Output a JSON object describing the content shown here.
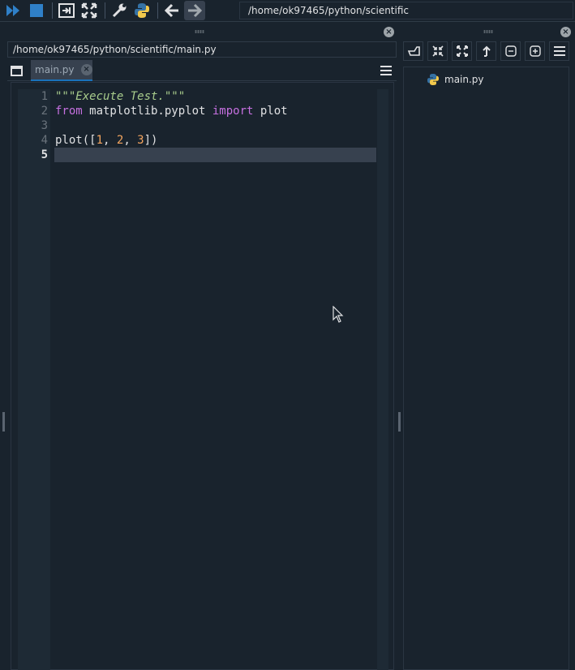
{
  "toolbar": {
    "path": "/home/ok97465/python/scientific",
    "icons": [
      "run-icon",
      "stop-icon",
      "maximize-editor-icon",
      "fullscreen-icon",
      "preferences-icon",
      "python-icon",
      "back-arrow-icon",
      "forward-arrow-icon"
    ]
  },
  "editor": {
    "file_path": "/home/ok97465/python/scientific/main.py",
    "tab_label": "main.py",
    "line_numbers": [
      "1",
      "2",
      "3",
      "4",
      "5"
    ],
    "current_line": 5,
    "lines": {
      "l1": "\"\"\"Execute Test.\"\"\"",
      "l2_kw1": "from",
      "l2_mod": " matplotlib.pyplot ",
      "l2_kw2": "import",
      "l2_name": " plot",
      "l4_a": "plot([",
      "l4_n1": "1",
      "l4_b": ", ",
      "l4_n2": "2",
      "l4_c": ", ",
      "l4_n3": "3",
      "l4_d": "])"
    }
  },
  "files": {
    "items": [
      {
        "label": "main.py",
        "icon": "python-file-icon"
      }
    ]
  },
  "colors": {
    "background": "#19232d",
    "accent": "#1a72bb",
    "keyword": "#c670e0",
    "docstring": "#a8cc8c",
    "number": "#f3a55f"
  }
}
